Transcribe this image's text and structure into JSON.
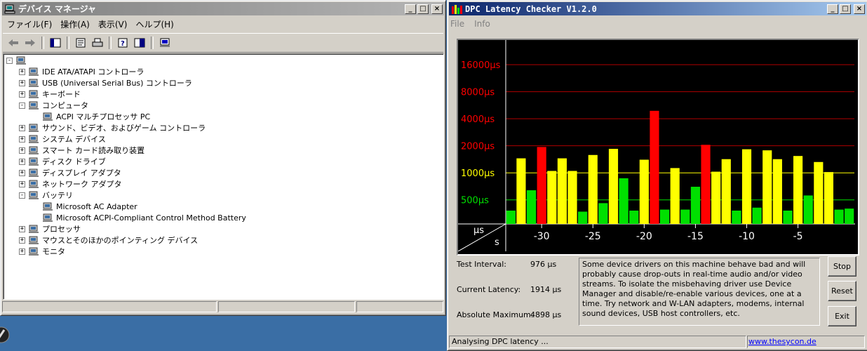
{
  "device_manager": {
    "title": "デバイス マネージャ",
    "menus": [
      "ファイル(F)",
      "操作(A)",
      "表示(V)",
      "ヘルプ(H)"
    ],
    "tree": [
      {
        "label": "",
        "level": 0,
        "expander": "-",
        "icon": "computer-icon"
      },
      {
        "label": "IDE ATA/ATAPI コントローラ",
        "level": 1,
        "expander": "+",
        "icon": "ide-controller-icon"
      },
      {
        "label": "USB (Universal Serial Bus) コントローラ",
        "level": 1,
        "expander": "+",
        "icon": "usb-icon"
      },
      {
        "label": "キーボード",
        "level": 1,
        "expander": "+",
        "icon": "keyboard-icon"
      },
      {
        "label": "コンピュータ",
        "level": 1,
        "expander": "-",
        "icon": "computer-icon"
      },
      {
        "label": "ACPI マルチプロセッサ PC",
        "level": 2,
        "expander": "",
        "icon": "computer-icon"
      },
      {
        "label": "サウンド、ビデオ、およびゲーム コントローラ",
        "level": 1,
        "expander": "+",
        "icon": "speaker-icon"
      },
      {
        "label": "システム デバイス",
        "level": 1,
        "expander": "+",
        "icon": "system-device-icon"
      },
      {
        "label": "スマート カード読み取り装置",
        "level": 1,
        "expander": "+",
        "icon": "smartcard-reader-icon"
      },
      {
        "label": "ディスク ドライブ",
        "level": 1,
        "expander": "+",
        "icon": "disk-drive-icon"
      },
      {
        "label": "ディスプレイ アダプタ",
        "level": 1,
        "expander": "+",
        "icon": "display-adapter-icon"
      },
      {
        "label": "ネットワーク アダプタ",
        "level": 1,
        "expander": "+",
        "icon": "network-adapter-icon"
      },
      {
        "label": "バッテリ",
        "level": 1,
        "expander": "-",
        "icon": "battery-icon"
      },
      {
        "label": "Microsoft AC Adapter",
        "level": 2,
        "expander": "",
        "icon": "battery-icon"
      },
      {
        "label": "Microsoft ACPI-Compliant Control Method Battery",
        "level": 2,
        "expander": "",
        "icon": "battery-icon"
      },
      {
        "label": "プロセッサ",
        "level": 1,
        "expander": "+",
        "icon": "processor-icon"
      },
      {
        "label": "マウスとそのほかのポインティング デバイス",
        "level": 1,
        "expander": "+",
        "icon": "mouse-icon"
      },
      {
        "label": "モニタ",
        "level": 1,
        "expander": "+",
        "icon": "monitor-icon"
      }
    ]
  },
  "dpc": {
    "title": "DPC Latency Checker V1.2.0",
    "menus": [
      "File",
      "Info"
    ],
    "labels": {
      "test_interval": "Test Interval:",
      "current_latency": "Current Latency:",
      "absolute_maximum": "Absolute Maximum:"
    },
    "values": {
      "test_interval": "976 µs",
      "current_latency": "1914 µs",
      "absolute_maximum": "4898 µs"
    },
    "message": "Some device drivers on this machine behave bad and will probably cause drop-outs in real-time audio and/or video streams. To isolate the misbehaving driver use Device Manager and disable/re-enable various devices, one at a time. Try network and W-LAN adapters, modems, internal sound devices, USB host controllers, etc.",
    "buttons": {
      "stop": "Stop",
      "reset": "Reset",
      "exit": "Exit"
    },
    "status": "Analysing DPC latency ...",
    "link": "www.thesycon.de",
    "colors": {
      "red": "#ff0000",
      "yellow": "#ffff00",
      "green": "#00e000"
    }
  },
  "chart_data": {
    "type": "bar",
    "title": "",
    "xlabel": "s",
    "ylabel": "µs",
    "y_scale": "log",
    "y_ticks": [
      {
        "value": 500,
        "label": "500µs",
        "color": "#00e000"
      },
      {
        "value": 1000,
        "label": "1000µs",
        "color": "#ffff00"
      },
      {
        "value": 2000,
        "label": "2000µs",
        "color": "#ff0000"
      },
      {
        "value": 4000,
        "label": "4000µs",
        "color": "#ff0000"
      },
      {
        "value": 8000,
        "label": "8000µs",
        "color": "#ff0000"
      },
      {
        "value": 16000,
        "label": "16000µs",
        "color": "#ff0000"
      }
    ],
    "x_ticks": [
      -30,
      -25,
      -20,
      -15,
      -10,
      -5
    ],
    "x_range": [
      -33.5,
      0.5
    ],
    "ylim": [
      270,
      29000
    ],
    "x": [
      -33,
      -32,
      -31,
      -30,
      -29,
      -28,
      -27,
      -26,
      -25,
      -24,
      -23,
      -22,
      -21,
      -20,
      -19,
      -18,
      -17,
      -16,
      -15,
      -14,
      -13,
      -12,
      -11,
      -10,
      -9,
      -8,
      -7,
      -6,
      -5,
      -4,
      -3,
      -2,
      -1,
      0
    ],
    "values": [
      380,
      1450,
      640,
      1940,
      1050,
      1450,
      1050,
      370,
      1580,
      460,
      1850,
      870,
      380,
      1400,
      4900,
      390,
      1130,
      390,
      700,
      2050,
      1030,
      1420,
      380,
      1830,
      410,
      1780,
      1420,
      380,
      1540,
      560,
      1320,
      1020,
      390,
      400
    ],
    "colors": [
      "#00e000",
      "#ffff00",
      "#00e000",
      "#ff0000",
      "#ffff00",
      "#ffff00",
      "#ffff00",
      "#00e000",
      "#ffff00",
      "#00e000",
      "#ffff00",
      "#00e000",
      "#00e000",
      "#ffff00",
      "#ff0000",
      "#00e000",
      "#ffff00",
      "#00e000",
      "#00e000",
      "#ff0000",
      "#ffff00",
      "#ffff00",
      "#00e000",
      "#ffff00",
      "#00e000",
      "#ffff00",
      "#ffff00",
      "#00e000",
      "#ffff00",
      "#00e000",
      "#ffff00",
      "#ffff00",
      "#00e000",
      "#00e000"
    ]
  }
}
